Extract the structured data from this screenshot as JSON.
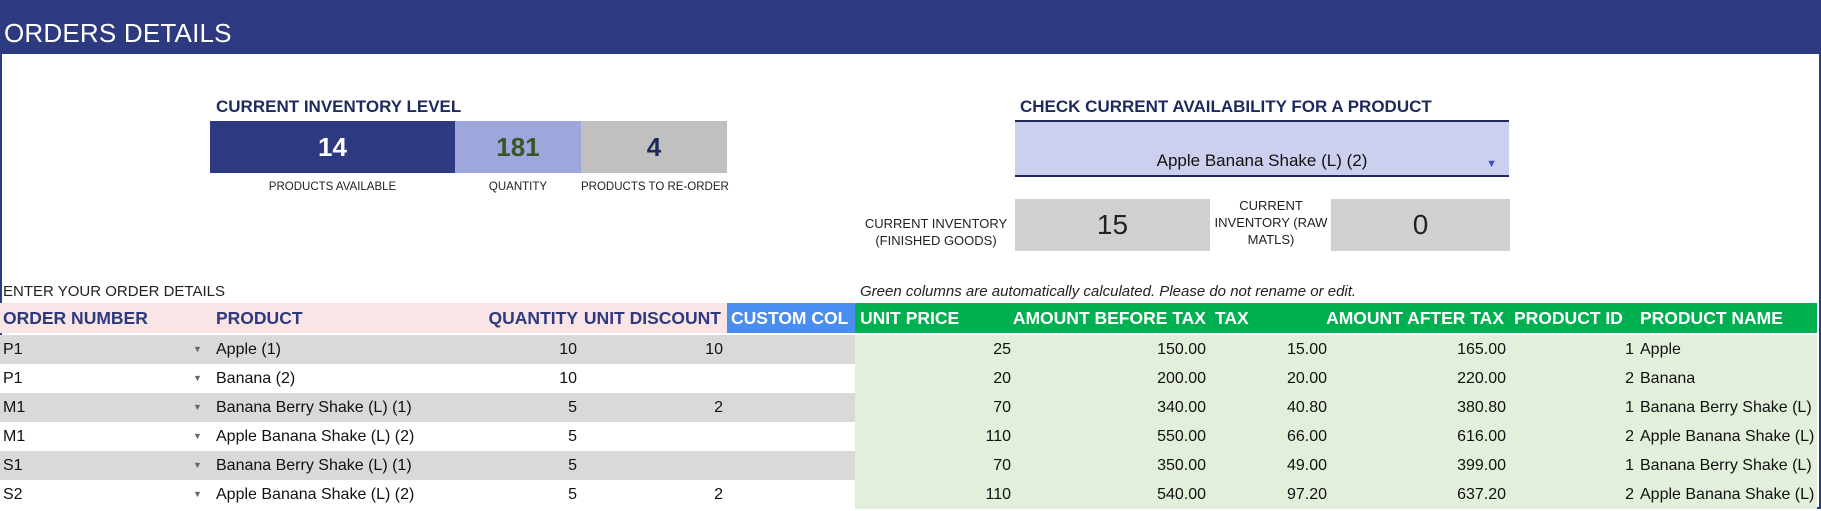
{
  "title": "ORDERS DETAILS",
  "inventory": {
    "title": "CURRENT INVENTORY LEVEL",
    "kpis": [
      {
        "value": "14",
        "label": "PRODUCTS AVAILABLE",
        "color": "#2e3a7f"
      },
      {
        "value": "181",
        "label": "QUANTITY",
        "color": "#9ea7db"
      },
      {
        "value": "4",
        "label": "PRODUCTS TO RE-ORDER",
        "color": "#c0c0c0"
      }
    ]
  },
  "availability": {
    "title": "CHECK CURRENT AVAILABILITY FOR A PRODUCT",
    "selected_product": "Apple Banana Shake (L) (2)",
    "finished_label": "CURRENT INVENTORY\n(FINISHED GOODS)",
    "finished_value": "15",
    "raw_label": "CURRENT\nINVENTORY (RAW\nMATLS)",
    "raw_value": "0"
  },
  "order_label": "ENTER YOUR  ORDER DETAILS",
  "auto_note": "Green columns are automatically calculated. Please do not rename or edit.",
  "columns": [
    "ORDER NUMBER",
    "PRODUCT",
    "QUANTITY",
    "UNIT DISCOUNT",
    "CUSTOM COL",
    "UNIT PRICE",
    "AMOUNT BEFORE TAX",
    "TAX",
    "AMOUNT AFTER TAX",
    "PRODUCT ID",
    "PRODUCT NAME"
  ],
  "colors": {
    "header_pink": "#f9e4e6",
    "custom_blue": "#4a8df0",
    "calc_green": "#00b050",
    "calc_light": "#e2efda",
    "navy": "#2e3a7f"
  },
  "rows": [
    {
      "order": "P1",
      "product": "Apple (1)",
      "quantity": "10",
      "discount": "10",
      "custom": "",
      "unit_price": "25",
      "amount_before": "150.00",
      "tax": "15.00",
      "amount_after": "165.00",
      "product_id": "1",
      "product_name": "Apple"
    },
    {
      "order": "P1",
      "product": "Banana (2)",
      "quantity": "10",
      "discount": "",
      "custom": "",
      "unit_price": "20",
      "amount_before": "200.00",
      "tax": "20.00",
      "amount_after": "220.00",
      "product_id": "2",
      "product_name": "Banana"
    },
    {
      "order": "M1",
      "product": "Banana Berry Shake (L) (1)",
      "quantity": "5",
      "discount": "2",
      "custom": "",
      "unit_price": "70",
      "amount_before": "340.00",
      "tax": "40.80",
      "amount_after": "380.80",
      "product_id": "1",
      "product_name": "Banana Berry Shake (L)"
    },
    {
      "order": "M1",
      "product": "Apple Banana Shake (L) (2)",
      "quantity": "5",
      "discount": "",
      "custom": "",
      "unit_price": "110",
      "amount_before": "550.00",
      "tax": "66.00",
      "amount_after": "616.00",
      "product_id": "2",
      "product_name": "Apple Banana Shake (L)"
    },
    {
      "order": "S1",
      "product": "Banana Berry Shake (L) (1)",
      "quantity": "5",
      "discount": "",
      "custom": "",
      "unit_price": "70",
      "amount_before": "350.00",
      "tax": "49.00",
      "amount_after": "399.00",
      "product_id": "1",
      "product_name": "Banana Berry Shake (L)"
    },
    {
      "order": "S2",
      "product": "Apple Banana Shake (L) (2)",
      "quantity": "5",
      "discount": "2",
      "custom": "",
      "unit_price": "110",
      "amount_before": "540.00",
      "tax": "97.20",
      "amount_after": "637.20",
      "product_id": "2",
      "product_name": "Apple Banana Shake (L)"
    }
  ]
}
